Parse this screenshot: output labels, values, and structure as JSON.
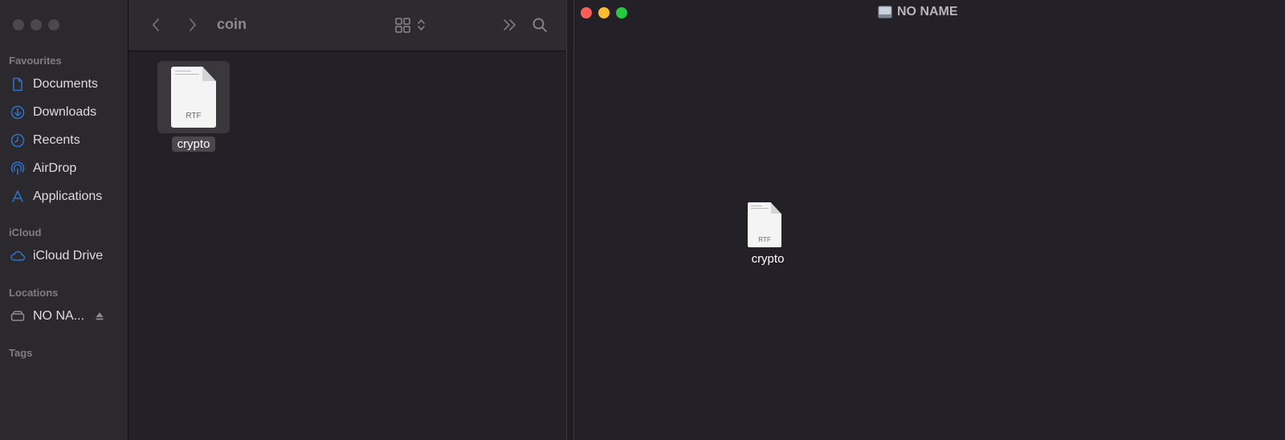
{
  "left_window": {
    "toolbar": {
      "title": "coin",
      "back_icon": "chevron-left-icon",
      "forward_icon": "chevron-right-icon",
      "view_icon": "grid-view-icon",
      "more_icon": "double-chevron-right-icon",
      "search_icon": "search-icon"
    },
    "sidebar": {
      "favourites_heading": "Favourites",
      "favourites": [
        {
          "label": "Documents",
          "icon": "document-icon"
        },
        {
          "label": "Downloads",
          "icon": "download-icon"
        },
        {
          "label": "Recents",
          "icon": "clock-icon"
        },
        {
          "label": "AirDrop",
          "icon": "airdrop-icon"
        },
        {
          "label": "Applications",
          "icon": "applications-icon"
        }
      ],
      "icloud_heading": "iCloud",
      "icloud": [
        {
          "label": "iCloud Drive",
          "icon": "cloud-icon"
        }
      ],
      "locations_heading": "Locations",
      "locations": [
        {
          "label": "NO NA...",
          "icon": "drive-icon",
          "eject_icon": "eject-icon"
        }
      ],
      "tags_heading": "Tags"
    },
    "files": [
      {
        "name": "crypto",
        "type_label": "RTF",
        "selected": true
      }
    ]
  },
  "right_window": {
    "title": "NO NAME",
    "title_icon": "disk-icon",
    "files": [
      {
        "name": "crypto",
        "type_label": "RTF"
      }
    ]
  },
  "colors": {
    "accent_icon": "#2f73c9",
    "traffic_red": "#ff5f57",
    "traffic_yellow": "#febc2e",
    "traffic_green": "#28c840"
  }
}
